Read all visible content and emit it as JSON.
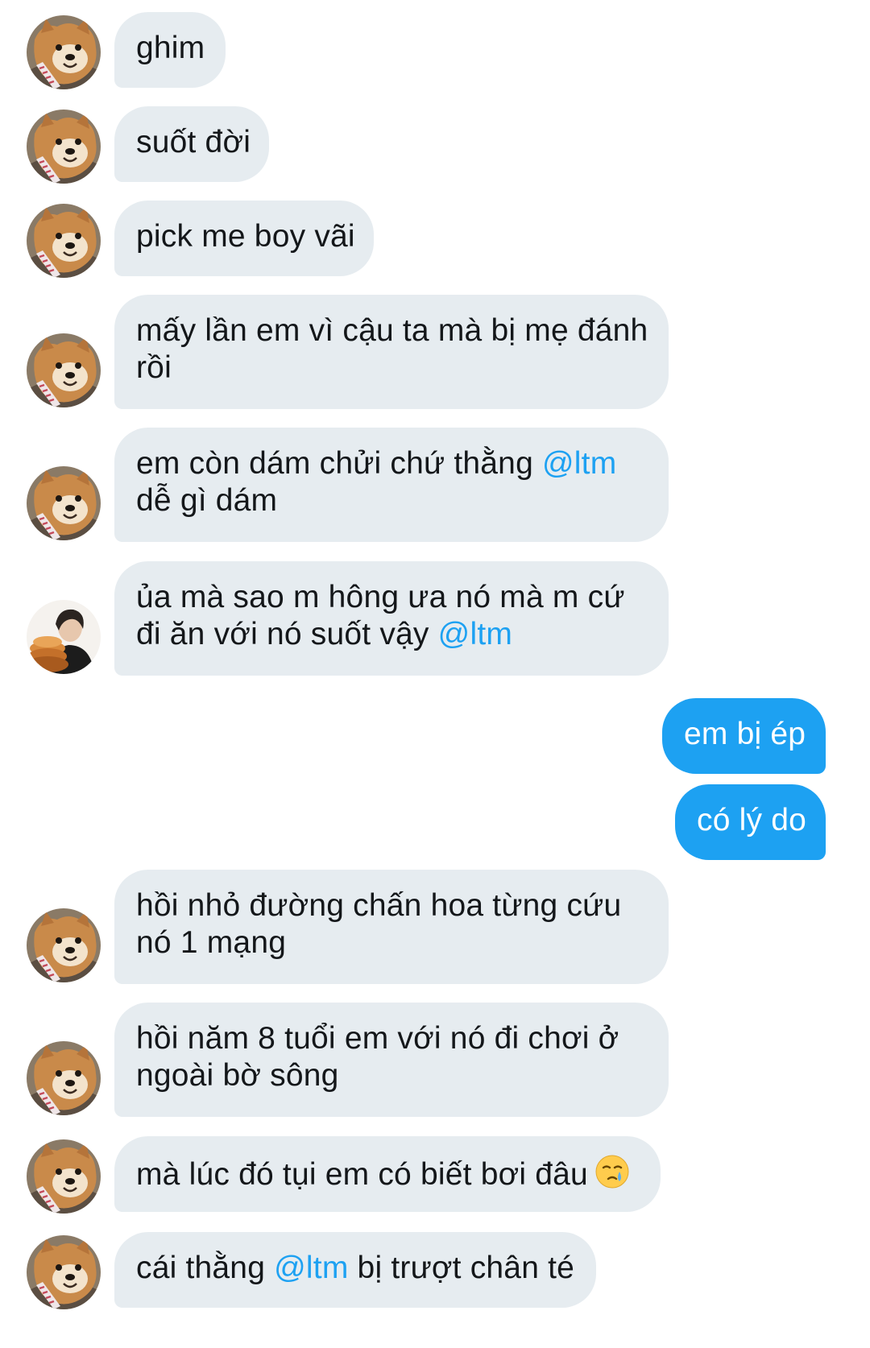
{
  "colors": {
    "incoming_bubble": "#e6ecf0",
    "outgoing_bubble": "#1da1f2",
    "mention": "#1da1f2",
    "text": "#14171a"
  },
  "messages": [
    {
      "dir": "in",
      "avatar": "shiba-dog-avatar",
      "lines": [
        "ghim"
      ]
    },
    {
      "dir": "in",
      "avatar": "shiba-dog-avatar",
      "lines": [
        "suốt đời"
      ]
    },
    {
      "dir": "in",
      "avatar": "shiba-dog-avatar",
      "lines": [
        "pick me boy vãi"
      ]
    },
    {
      "dir": "in",
      "avatar": "shiba-dog-avatar",
      "lines": [
        "mấy lần em vì cậu ta mà bị mẹ đánh",
        "rồi"
      ]
    },
    {
      "dir": "in",
      "avatar": "shiba-dog-avatar",
      "line1_pre": "em còn dám chửi chứ thằng ",
      "mention": "@ltm",
      "line2": "dễ gì dám"
    },
    {
      "dir": "in",
      "avatar": "person-cake-avatar",
      "line1": "ủa mà sao m hông ưa nó mà m cứ",
      "line2_pre": "đi ăn với nó suốt vậy ",
      "mention": "@ltm"
    },
    {
      "dir": "out",
      "lines": [
        "em bị ép"
      ]
    },
    {
      "dir": "out",
      "lines": [
        "có lý do"
      ]
    },
    {
      "dir": "in",
      "avatar": "shiba-dog-avatar",
      "lines": [
        "hồi nhỏ đường chấn hoa từng cứu",
        "nó 1 mạng"
      ]
    },
    {
      "dir": "in",
      "avatar": "shiba-dog-avatar",
      "lines": [
        "hồi năm 8 tuổi em với nó đi chơi ở",
        "ngoài bờ sông"
      ]
    },
    {
      "dir": "in",
      "avatar": "shiba-dog-avatar",
      "text": "mà lúc đó tụi em có biết bơi đâu",
      "emoji": "crying-face-emoji"
    },
    {
      "dir": "in",
      "avatar": "shiba-dog-avatar",
      "pre": "cái thằng ",
      "mention": "@ltm",
      "post": " bị trượt chân té"
    }
  ]
}
